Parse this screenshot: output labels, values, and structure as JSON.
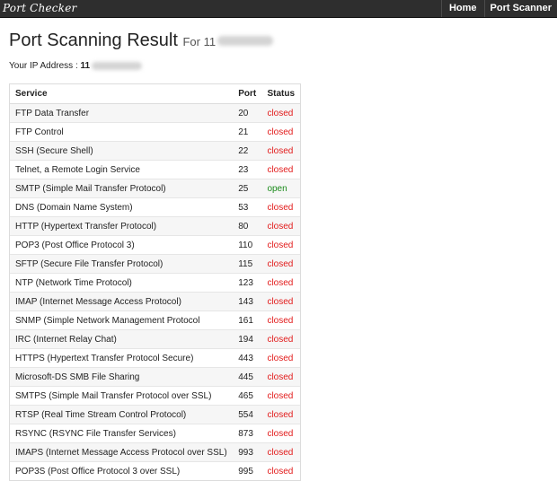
{
  "nav": {
    "brand": "Port Checker",
    "links": [
      "Home",
      "Port Scanner"
    ]
  },
  "page": {
    "title": "Port Scanning Result",
    "for_label": "For 11",
    "ip_label": "Your IP Address : ",
    "ip_value": "11"
  },
  "table": {
    "headers": [
      "Service",
      "Port",
      "Status"
    ],
    "rows": [
      {
        "service": "FTP Data Transfer",
        "port": "20",
        "status": "closed"
      },
      {
        "service": "FTP Control",
        "port": "21",
        "status": "closed"
      },
      {
        "service": "SSH (Secure Shell)",
        "port": "22",
        "status": "closed"
      },
      {
        "service": "Telnet, a Remote Login Service",
        "port": "23",
        "status": "closed"
      },
      {
        "service": "SMTP (Simple Mail Transfer Protocol)",
        "port": "25",
        "status": "open"
      },
      {
        "service": "DNS (Domain Name System)",
        "port": "53",
        "status": "closed"
      },
      {
        "service": "HTTP (Hypertext Transfer Protocol)",
        "port": "80",
        "status": "closed"
      },
      {
        "service": "POP3 (Post Office Protocol 3)",
        "port": "110",
        "status": "closed"
      },
      {
        "service": "SFTP (Secure File Transfer Protocol)",
        "port": "115",
        "status": "closed"
      },
      {
        "service": "NTP (Network Time Protocol)",
        "port": "123",
        "status": "closed"
      },
      {
        "service": "IMAP (Internet Message Access Protocol)",
        "port": "143",
        "status": "closed"
      },
      {
        "service": "SNMP (Simple Network Management Protocol",
        "port": "161",
        "status": "closed"
      },
      {
        "service": "IRC (Internet Relay Chat)",
        "port": "194",
        "status": "closed"
      },
      {
        "service": "HTTPS (Hypertext Transfer Protocol Secure)",
        "port": "443",
        "status": "closed"
      },
      {
        "service": "Microsoft-DS SMB File Sharing",
        "port": "445",
        "status": "closed"
      },
      {
        "service": "SMTPS (Simple Mail Transfer Protocol over SSL)",
        "port": "465",
        "status": "closed"
      },
      {
        "service": "RTSP (Real Time Stream Control Protocol)",
        "port": "554",
        "status": "closed"
      },
      {
        "service": "RSYNC (RSYNC File Transfer Services)",
        "port": "873",
        "status": "closed"
      },
      {
        "service": "IMAPS (Internet Message Access Protocol over SSL)",
        "port": "993",
        "status": "closed"
      },
      {
        "service": "POP3S (Post Office Protocol 3 over SSL)",
        "port": "995",
        "status": "closed"
      }
    ]
  },
  "colors": {
    "navbar": "#2e2e2e",
    "closed": "#e21b1b",
    "open": "#1a8a1a"
  }
}
